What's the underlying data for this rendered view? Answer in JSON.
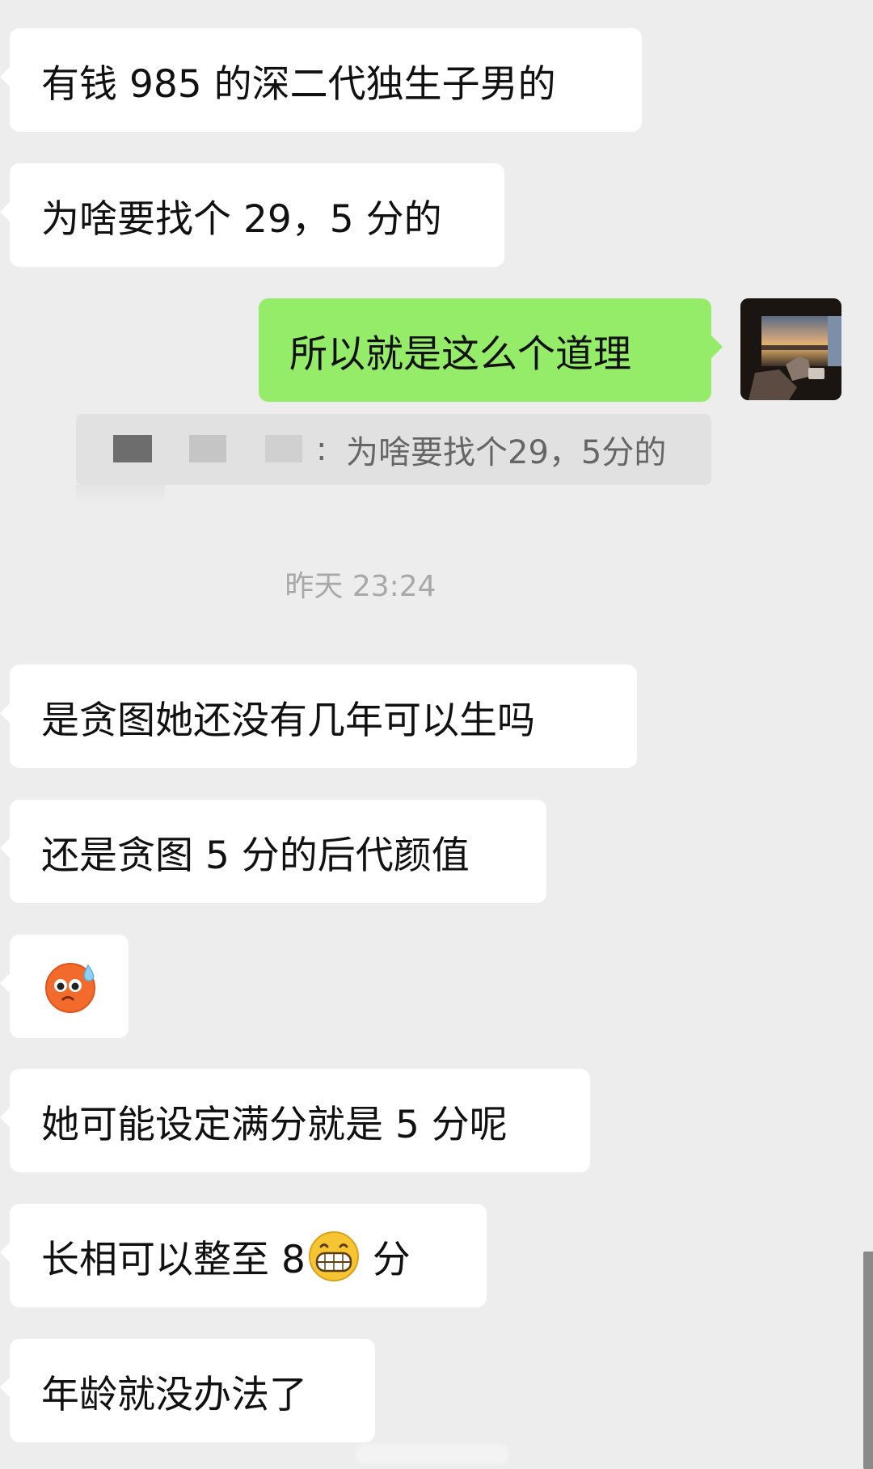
{
  "messages": [
    {
      "text": "有钱 985 的深二代独生子男的"
    },
    {
      "text": "为啥要找个 29，5 分的"
    },
    {
      "text": "所以就是这么个道理"
    },
    {
      "text": "是贪图她还没有几年可以生吗"
    },
    {
      "text": "还是贪图 5 分的后代颜值"
    },
    {
      "emoji": "sweating-face-emoji"
    },
    {
      "text": "她可能设定满分就是 5 分呢"
    },
    {
      "text_before": "长相可以整至 8",
      "emoji": "grinning-face-emoji",
      "text_after": " 分"
    },
    {
      "text": "年龄就没办法了"
    }
  ],
  "quote": {
    "sender_separator": ":",
    "text": "为啥要找个29，5分的"
  },
  "timestamp": "昨天 23:24",
  "colors": {
    "background": "#ededed",
    "incoming_bubble": "#ffffff",
    "outgoing_bubble": "#95ec69",
    "quote_background": "#e1e1e1",
    "timestamp_text": "#a8a8a8"
  }
}
